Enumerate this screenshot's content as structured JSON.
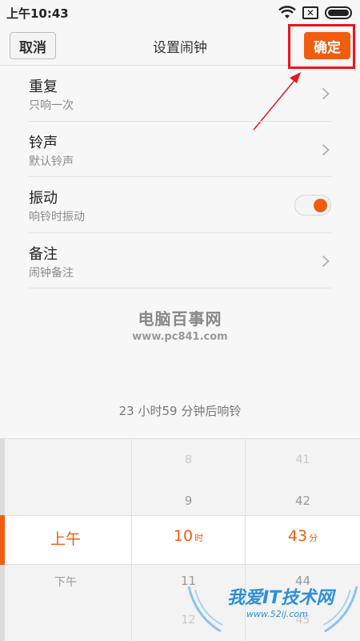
{
  "status": {
    "time": "上午10:43",
    "sim_label": "✕"
  },
  "header": {
    "cancel_label": "取消",
    "title": "设置闹钟",
    "confirm_label": "确定"
  },
  "settings": [
    {
      "title": "重复",
      "subtitle": "只响一次"
    },
    {
      "title": "铃声",
      "subtitle": "默认铃声"
    },
    {
      "title": "振动",
      "subtitle": "响铃时振动",
      "toggle": true
    },
    {
      "title": "备注",
      "subtitle": "闹钟备注"
    }
  ],
  "watermark_top": {
    "title": "电脑百事网",
    "url": "www.pc841.com"
  },
  "countdown": "23 小时59 分钟后响铃",
  "picker": {
    "ampm": {
      "selected": "上午",
      "below": "下午"
    },
    "hour": {
      "items": [
        "8",
        "9",
        "11",
        "12"
      ],
      "selected": "10",
      "unit": "时"
    },
    "minute": {
      "items": [
        "41",
        "42",
        "44",
        "45"
      ],
      "selected": "43",
      "unit": "分"
    }
  },
  "watermark_bottom": {
    "title": "我爱IT技术网",
    "url": "www.52ij.com"
  },
  "colors": {
    "accent": "#f05d10",
    "highlight": "#e8171d",
    "watermark_blue": "#2f8fd8"
  },
  "icons": [
    "wifi-icon",
    "sim-x-icon",
    "battery-icon",
    "chevron-right-icon",
    "toggle-switch"
  ]
}
